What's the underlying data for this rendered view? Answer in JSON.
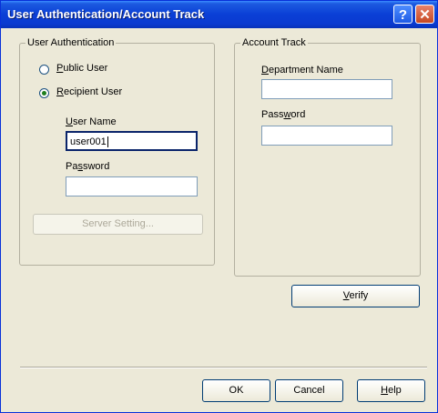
{
  "window": {
    "title": "User Authentication/Account Track",
    "help_icon": "question-mark",
    "close_icon": "x"
  },
  "user_auth": {
    "group_label": "User Authentication",
    "public_user": "Public User",
    "recipient_user": "Recipient User",
    "selected": "Recipient User",
    "user_name_label": "User Name",
    "user_name_value": "user001",
    "password_label": "Password",
    "password_value": "",
    "server_setting": "Server Setting..."
  },
  "account_track": {
    "group_label": "Account Track",
    "department_label": "Department Name",
    "department_value": "",
    "password_label": "Password",
    "password_value": ""
  },
  "buttons": {
    "verify": "Verify",
    "ok": "OK",
    "cancel": "Cancel",
    "help": "Help"
  }
}
